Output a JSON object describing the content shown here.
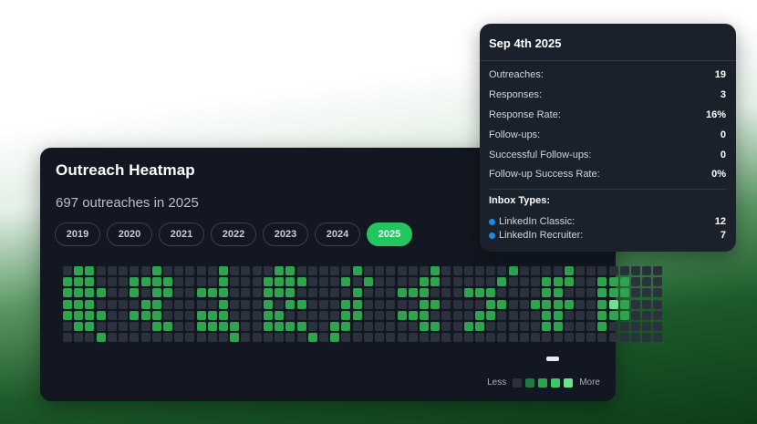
{
  "heatmap": {
    "title": "Outreach Heatmap",
    "subtitle": "697 outreaches in 2025",
    "years": [
      "2019",
      "2020",
      "2021",
      "2022",
      "2023",
      "2024",
      "2025"
    ],
    "active_year": "2025",
    "legend_less": "Less",
    "legend_more": "More",
    "level_colors": [
      "#2c323d",
      "#1f7a3d",
      "#2ea44f",
      "#39c86a",
      "#6fe08f"
    ],
    "months": [
      [
        [
          0,
          2,
          2,
          0,
          0,
          0
        ],
        [
          2,
          2,
          2,
          0,
          0,
          0
        ],
        [
          2,
          2,
          2,
          2,
          0,
          0
        ],
        [
          2,
          2,
          2,
          0,
          0,
          0
        ],
        [
          2,
          2,
          2,
          2,
          0,
          0
        ],
        [
          0,
          2,
          2,
          0,
          0,
          0
        ],
        [
          0,
          0,
          0,
          2,
          0,
          0
        ]
      ],
      [
        [
          0,
          0,
          2,
          0,
          0,
          0
        ],
        [
          2,
          2,
          2,
          2,
          0,
          0
        ],
        [
          2,
          0,
          2,
          2,
          0,
          0
        ],
        [
          0,
          2,
          2,
          0,
          0,
          0
        ],
        [
          2,
          2,
          2,
          0,
          0,
          0
        ],
        [
          0,
          0,
          2,
          2,
          0,
          0
        ],
        [
          0,
          0,
          0,
          0,
          0,
          0
        ]
      ],
      [
        [
          0,
          0,
          2,
          0,
          0,
          0
        ],
        [
          0,
          0,
          2,
          0,
          0,
          0
        ],
        [
          2,
          2,
          2,
          0,
          0,
          0
        ],
        [
          0,
          0,
          2,
          0,
          0,
          0
        ],
        [
          2,
          2,
          2,
          0,
          0,
          0
        ],
        [
          2,
          2,
          2,
          2,
          0,
          0
        ],
        [
          0,
          0,
          0,
          2,
          0,
          0
        ]
      ],
      [
        [
          0,
          2,
          2,
          0,
          0,
          0
        ],
        [
          2,
          2,
          2,
          2,
          0,
          0
        ],
        [
          2,
          2,
          2,
          0,
          0,
          0
        ],
        [
          2,
          0,
          2,
          2,
          0,
          0
        ],
        [
          2,
          2,
          0,
          0,
          0,
          0
        ],
        [
          2,
          2,
          2,
          2,
          0,
          0
        ],
        [
          0,
          0,
          0,
          0,
          2,
          0
        ]
      ],
      [
        [
          0,
          0,
          2,
          0,
          0,
          0
        ],
        [
          0,
          2,
          0,
          2,
          0,
          0
        ],
        [
          0,
          0,
          2,
          0,
          0,
          0
        ],
        [
          0,
          2,
          2,
          0,
          0,
          0
        ],
        [
          0,
          2,
          2,
          0,
          0,
          0
        ],
        [
          2,
          2,
          0,
          0,
          0,
          0
        ],
        [
          2,
          0,
          0,
          0,
          0,
          0
        ]
      ],
      [
        [
          0,
          0,
          0,
          2,
          0,
          0
        ],
        [
          0,
          0,
          2,
          2,
          0,
          0
        ],
        [
          2,
          2,
          2,
          0,
          0,
          0
        ],
        [
          0,
          0,
          2,
          2,
          0,
          0
        ],
        [
          2,
          2,
          2,
          0,
          0,
          0
        ],
        [
          0,
          0,
          2,
          2,
          0,
          0
        ],
        [
          0,
          0,
          0,
          0,
          0,
          0
        ]
      ],
      [
        [
          0,
          0,
          0,
          0,
          2,
          0
        ],
        [
          0,
          0,
          0,
          2,
          0,
          0
        ],
        [
          2,
          2,
          2,
          0,
          0,
          0
        ],
        [
          0,
          0,
          2,
          2,
          0,
          0
        ],
        [
          0,
          2,
          2,
          0,
          0,
          0
        ],
        [
          2,
          2,
          0,
          0,
          0,
          0
        ],
        [
          0,
          0,
          0,
          0,
          0,
          0
        ]
      ],
      [
        [
          0,
          0,
          0,
          2,
          0,
          0
        ],
        [
          0,
          2,
          2,
          2,
          0,
          0
        ],
        [
          0,
          2,
          2,
          0,
          0,
          0
        ],
        [
          2,
          2,
          2,
          2,
          0,
          0
        ],
        [
          0,
          2,
          2,
          0,
          0,
          0
        ],
        [
          0,
          2,
          2,
          0,
          0,
          0
        ],
        [
          0,
          0,
          0,
          0,
          0,
          0
        ]
      ],
      [
        [
          0,
          0,
          0,
          0,
          0,
          0
        ],
        [
          2,
          2,
          2,
          0,
          0,
          0
        ],
        [
          2,
          2,
          2,
          0,
          0,
          0
        ],
        [
          2,
          4,
          2,
          0,
          0,
          0
        ],
        [
          2,
          2,
          2,
          0,
          0,
          0
        ],
        [
          2,
          0,
          0,
          0,
          0,
          0
        ],
        [
          0,
          0,
          0,
          0,
          0,
          0
        ]
      ]
    ]
  },
  "tooltip": {
    "date": "Sep 4th 2025",
    "stats": [
      {
        "label": "Outreaches:",
        "value": "19"
      },
      {
        "label": "Responses:",
        "value": "3"
      },
      {
        "label": "Response Rate:",
        "value": "16%"
      },
      {
        "label": "Follow-ups:",
        "value": "0"
      },
      {
        "label": "Successful Follow-ups:",
        "value": "0"
      },
      {
        "label": "Follow-up Success Rate:",
        "value": "0%"
      }
    ],
    "inbox_title": "Inbox Types:",
    "inbox": [
      {
        "label": "LinkedIn Classic:",
        "value": "12",
        "color": "#1e88e5"
      },
      {
        "label": "LinkedIn Recruiter:",
        "value": "7",
        "color": "#1e88e5"
      }
    ]
  }
}
